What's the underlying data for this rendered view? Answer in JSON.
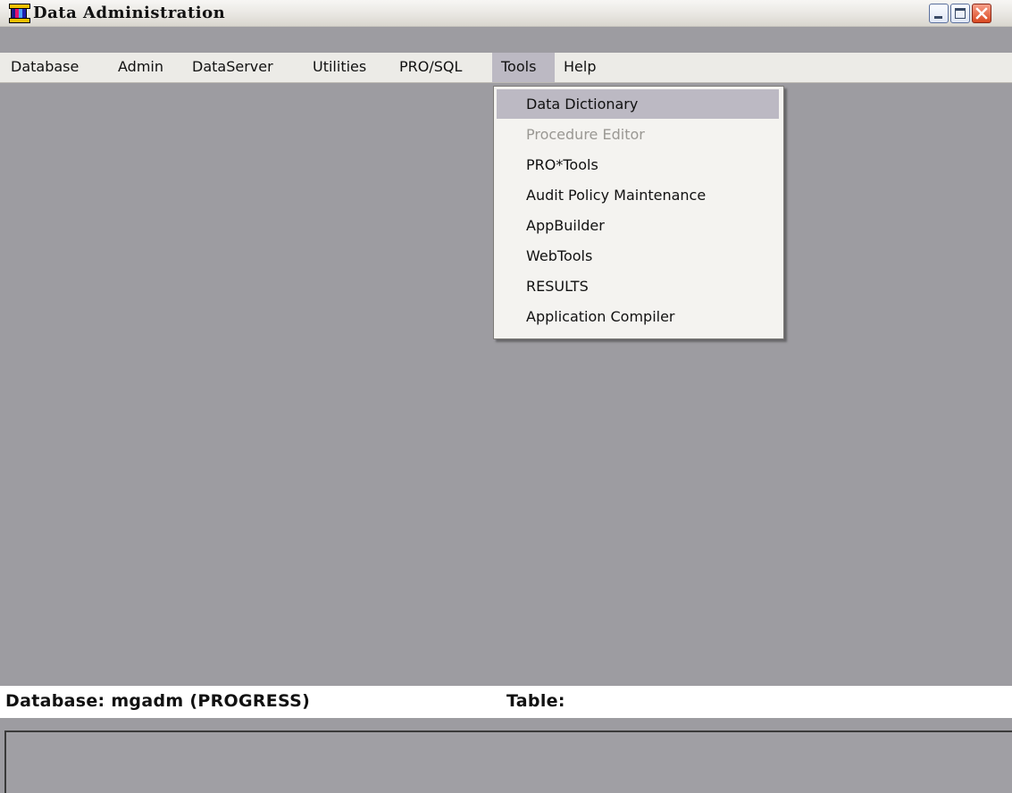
{
  "window": {
    "title": "Data Administration",
    "icon": "app-icon",
    "controls": [
      "minimize-icon",
      "maximize-icon",
      "close-icon"
    ]
  },
  "menubar": {
    "items": [
      {
        "label": "Database"
      },
      {
        "label": "Admin"
      },
      {
        "label": "DataServer"
      },
      {
        "label": "Utilities"
      },
      {
        "label": "PRO/SQL"
      },
      {
        "label": "Tools",
        "active": true
      },
      {
        "label": "Help"
      }
    ]
  },
  "tools_menu": {
    "items": [
      {
        "label": "Data Dictionary",
        "highlighted": true
      },
      {
        "label": "Procedure Editor",
        "disabled": true
      },
      {
        "label": "PRO*Tools"
      },
      {
        "label": "Audit Policy Maintenance"
      },
      {
        "label": "AppBuilder"
      },
      {
        "label": "WebTools"
      },
      {
        "label": "RESULTS"
      },
      {
        "label": "Application Compiler"
      }
    ]
  },
  "status": {
    "database_label": "Database: mgadm (PROGRESS)",
    "table_label": "Table:"
  },
  "colors": {
    "workspace": "#9d9ca1",
    "menubar": "#ecebe7",
    "highlight": "#bcb9c3",
    "disabled_text": "#9a9893"
  }
}
